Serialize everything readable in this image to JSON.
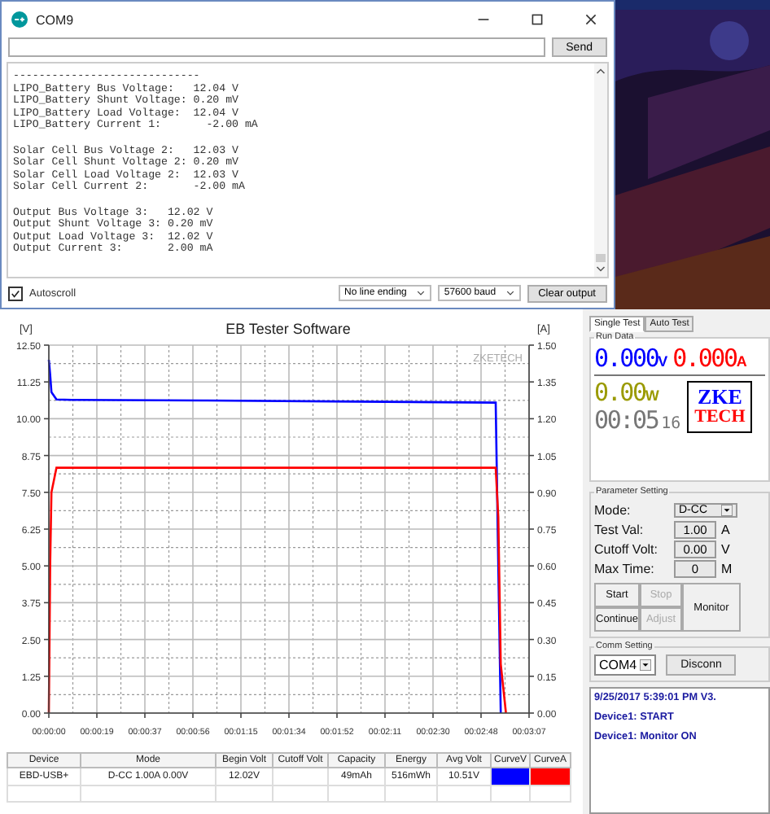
{
  "serial_monitor": {
    "title": "COM9",
    "send_button": "Send",
    "blocks": [
      [
        "-----------------------------",
        "LIPO_Battery Bus Voltage:   12.04 V",
        "LIPO_Battery Shunt Voltage: 0.20 mV",
        "LIPO_Battery Load Voltage:  12.04 V",
        "LIPO_Battery Current 1:       -2.00 mA"
      ],
      [
        "Solar Cell Bus Voltage 2:   12.03 V",
        "Solar Cell Shunt Voltage 2: 0.20 mV",
        "Solar Cell Load Voltage 2:  12.03 V",
        "Solar Cell Current 2:       -2.00 mA"
      ],
      [
        "Output Bus Voltage 3:   12.02 V",
        "Output Shunt Voltage 3: 0.20 mV",
        "Output Load Voltage 3:  12.02 V",
        "Output Current 3:       2.00 mA"
      ]
    ],
    "autoscroll": {
      "label": "Autoscroll",
      "checked": true
    },
    "line_ending": "No line ending",
    "baud": "57600 baud",
    "clear_button": "Clear output"
  },
  "eb_tester": {
    "left_unit": "[V]",
    "right_unit": "[A]",
    "chart_label": "ZKETECH",
    "chart_data": {
      "type": "line",
      "title": "EB Tester Software",
      "x": [
        0,
        0.5,
        1,
        3,
        9,
        60,
        120,
        174,
        175,
        176,
        178
      ],
      "series": [
        {
          "color": "#0000ff",
          "values": [
            12.0,
            11.5,
            10.9,
            10.65,
            10.64,
            10.62,
            10.58,
            10.55,
            5.0,
            0.0,
            null
          ]
        },
        {
          "color": "#ff0000",
          "axis": "y2",
          "values": [
            0.0,
            0.6,
            0.9,
            1.0,
            1.0,
            1.0,
            1.0,
            1.0,
            0.8,
            0.2,
            0.0
          ]
        }
      ],
      "grid": true,
      "xlim": [
        0,
        187
      ],
      "ylim": [
        0,
        12.5
      ],
      "y2lim": [
        0,
        1.5
      ],
      "xticks": [
        {
          "value": 0,
          "label": "00:00:00"
        },
        {
          "value": 18.7,
          "label": "00:00:19"
        },
        {
          "value": 37.4,
          "label": "00:00:37"
        },
        {
          "value": 56.1,
          "label": "00:00:56"
        },
        {
          "value": 74.8,
          "label": "00:01:15"
        },
        {
          "value": 93.5,
          "label": "00:01:34"
        },
        {
          "value": 112.2,
          "label": "00:01:52"
        },
        {
          "value": 130.9,
          "label": "00:02:11"
        },
        {
          "value": 149.6,
          "label": "00:02:30"
        },
        {
          "value": 168.3,
          "label": "00:02:48"
        },
        {
          "value": 187,
          "label": "00:03:07"
        }
      ],
      "yticks": [
        {
          "value": 0,
          "label": "0.00"
        },
        {
          "value": 1.25,
          "label": "1.25"
        },
        {
          "value": 2.5,
          "label": "2.50"
        },
        {
          "value": 3.75,
          "label": "3.75"
        },
        {
          "value": 5,
          "label": "5.00"
        },
        {
          "value": 6.25,
          "label": "6.25"
        },
        {
          "value": 7.5,
          "label": "7.50"
        },
        {
          "value": 8.75,
          "label": "8.75"
        },
        {
          "value": 10,
          "label": "10.00"
        },
        {
          "value": 11.25,
          "label": "11.25"
        },
        {
          "value": 12.5,
          "label": "12.50"
        }
      ],
      "y2ticks": [
        {
          "value": 0,
          "label": "0.00"
        },
        {
          "value": 0.15,
          "label": "0.15"
        },
        {
          "value": 0.3,
          "label": "0.30"
        },
        {
          "value": 0.45,
          "label": "0.45"
        },
        {
          "value": 0.6,
          "label": "0.60"
        },
        {
          "value": 0.75,
          "label": "0.75"
        },
        {
          "value": 0.9,
          "label": "0.90"
        },
        {
          "value": 1.05,
          "label": "1.05"
        },
        {
          "value": 1.2,
          "label": "1.20"
        },
        {
          "value": 1.35,
          "label": "1.35"
        },
        {
          "value": 1.5,
          "label": "1.50"
        }
      ]
    },
    "table": {
      "columns": [
        "Device",
        "Mode",
        "Begin Volt",
        "Cutoff Volt",
        "Capacity",
        "Energy",
        "Avg Volt",
        "CurveV",
        "CurveA"
      ],
      "rows": [
        {
          "cells": [
            "EBD-USB+",
            "D-CC 1.00A 0.00V",
            "12.02V",
            "",
            "49mAh",
            "516mWh",
            "10.51V"
          ],
          "curves": [
            {
              "color": "#0000ff"
            },
            {
              "color": "#ff0000"
            }
          ]
        }
      ]
    },
    "panel": {
      "tabs": [
        {
          "label": "Single Test",
          "selected": true
        },
        {
          "label": "Auto Test",
          "selected": false
        }
      ],
      "run_data": {
        "title": "Run Data",
        "voltage": "0.000",
        "voltage_unit": "V",
        "current": "0.000",
        "current_unit": "A",
        "power": "0.00",
        "power_unit": "W",
        "time": "00:05",
        "time_seconds": "16"
      },
      "logo": {
        "top": "ZKE",
        "bottom": "TECH"
      },
      "parameters": {
        "title": "Parameter Setting",
        "mode_label": "Mode:",
        "mode": "D-CC",
        "fields": [
          {
            "label": "Test Val:",
            "value": "1.00",
            "unit": "A"
          },
          {
            "label": "Cutoff Volt:",
            "value": "0.00",
            "unit": "V"
          },
          {
            "label": "Max Time:",
            "value": "0",
            "unit": "M"
          }
        ],
        "buttons": [
          {
            "label": "Start",
            "disabled": false
          },
          {
            "label": "Stop",
            "disabled": true
          },
          {
            "label": "Continue",
            "disabled": false
          },
          {
            "label": "Adjust",
            "disabled": true
          }
        ],
        "monitor_button": "Monitor"
      },
      "comm": {
        "title": "Comm Setting",
        "port": "COM4",
        "button": "Disconn"
      },
      "log": [
        "9/25/2017 5:39:01 PM  V3.",
        "Device1: START",
        "Device1: Monitor ON"
      ]
    }
  }
}
